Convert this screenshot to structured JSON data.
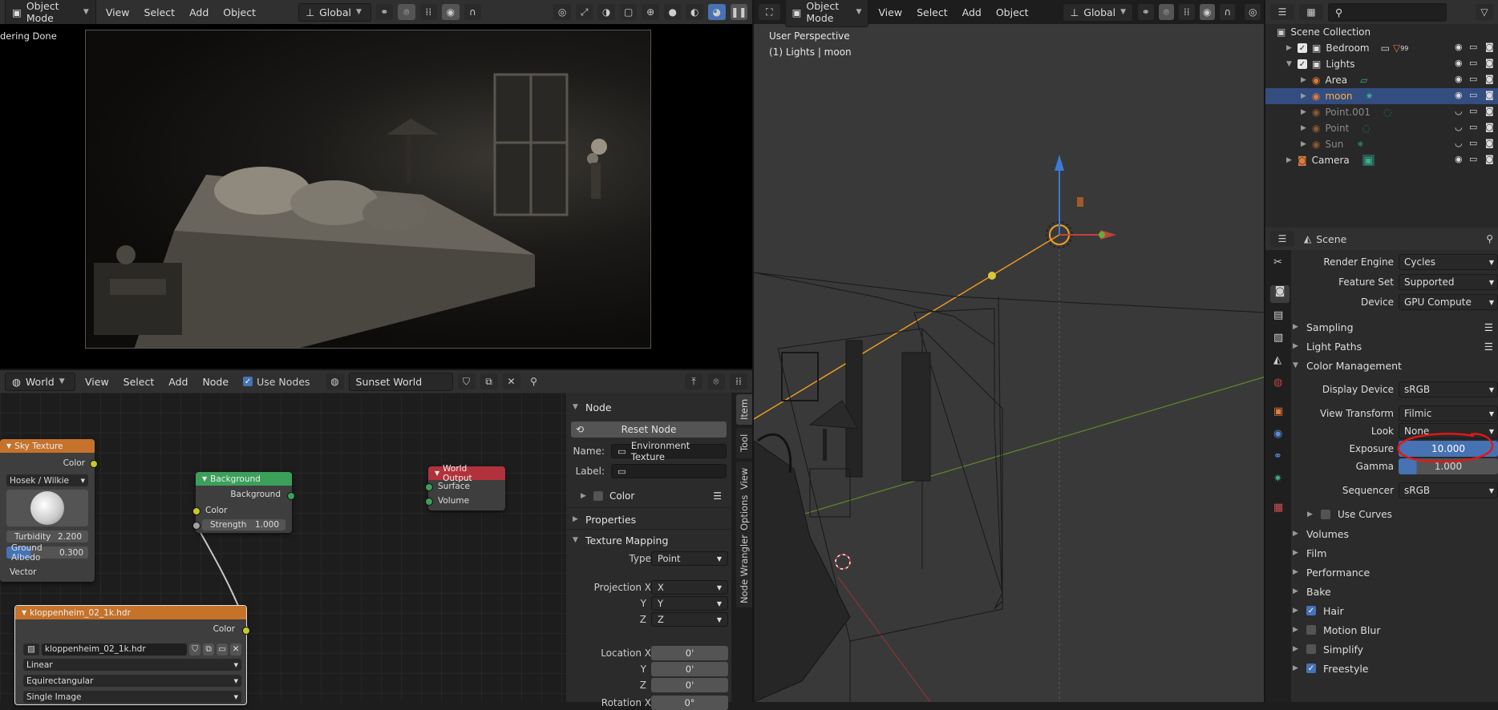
{
  "render_view": {
    "mode": "Object Mode",
    "menus": [
      "View",
      "Select",
      "Add",
      "Object"
    ],
    "orientation": "Global",
    "status": "dering Done"
  },
  "node_editor": {
    "editor_type": "World",
    "menus": [
      "View",
      "Select",
      "Add",
      "Node"
    ],
    "use_nodes_label": "Use Nodes",
    "world_name": "Sunset World",
    "nodes": {
      "sky": {
        "title": "Sky Texture",
        "out_color": "Color",
        "model": "Hosek / Wilkie",
        "turbidity_label": "Turbidity",
        "turbidity": "2.200",
        "albedo_label": "Ground Albedo",
        "albedo": "0.300",
        "in_vector": "Vector"
      },
      "background": {
        "title": "Background",
        "out": "Background",
        "in_color": "Color",
        "strength_label": "Strength",
        "strength": "1.000"
      },
      "world_output": {
        "title": "World Output",
        "surface": "Surface",
        "volume": "Volume"
      },
      "env": {
        "title": "kloppenheim_02_1k.hdr",
        "out_color": "Color",
        "image": "kloppenheim_02_1k.hdr",
        "interpolation": "Linear",
        "projection": "Equirectangular",
        "source": "Single Image"
      }
    },
    "panel": {
      "node_header": "Node",
      "reset_node": "Reset Node",
      "name_label": "Name:",
      "name_value": "Environment Texture",
      "label_label": "Label:",
      "label_value": "",
      "color_label": "Color",
      "properties_header": "Properties",
      "mapping_header": "Texture Mapping",
      "type_label": "Type",
      "type_value": "Point",
      "proj_x_label": "Projection X",
      "proj_x": "X",
      "proj_y_label": "Y",
      "proj_y": "Y",
      "proj_z_label": "Z",
      "proj_z": "Z",
      "loc_x_label": "Location X",
      "loc_x": "0'",
      "loc_y_label": "Y",
      "loc_y": "0'",
      "loc_z_label": "Z",
      "loc_z": "0'",
      "rot_x_label": "Rotation X",
      "rot_x": "0°"
    },
    "tabs": [
      "Item",
      "Tool",
      "View",
      "Options",
      "Node Wrangler"
    ]
  },
  "viewport": {
    "mode": "Object Mode",
    "menus": [
      "View",
      "Select",
      "Add",
      "Object"
    ],
    "orientation": "Global",
    "perspective": "User Perspective",
    "context": "(1) Lights | moon"
  },
  "outliner": {
    "root": "Scene Collection",
    "rows": [
      {
        "label": "Bedroom",
        "extra": "99"
      },
      {
        "label": "Lights"
      },
      {
        "label": "Area"
      },
      {
        "label": "moon"
      },
      {
        "label": "Point.001"
      },
      {
        "label": "Point"
      },
      {
        "label": "Sun"
      },
      {
        "label": "Camera"
      }
    ]
  },
  "properties": {
    "context": "Scene",
    "render_engine_label": "Render Engine",
    "render_engine": "Cycles",
    "feature_set_label": "Feature Set",
    "feature_set": "Supported",
    "device_label": "Device",
    "device": "GPU Compute",
    "sampling": "Sampling",
    "light_paths": "Light Paths",
    "color_management": "Color Management",
    "display_device_label": "Display Device",
    "display_device": "sRGB",
    "view_transform_label": "View Transform",
    "view_transform": "Filmic",
    "look_label": "Look",
    "look": "None",
    "exposure_label": "Exposure",
    "exposure": "10.000",
    "gamma_label": "Gamma",
    "gamma": "1.000",
    "sequencer_label": "Sequencer",
    "sequencer": "sRGB",
    "use_curves": "Use Curves",
    "volumes": "Volumes",
    "film": "Film",
    "performance": "Performance",
    "bake": "Bake",
    "hair": "Hair",
    "motion_blur": "Motion Blur",
    "simplify": "Simplify",
    "freestyle": "Freestyle"
  },
  "colors": {
    "accent": "#4772b3",
    "active_row": "#334d80",
    "node_texture": "#c5722b",
    "node_shader": "#3ba05a",
    "node_output": "#b1323a",
    "annotation": "#e01818"
  }
}
